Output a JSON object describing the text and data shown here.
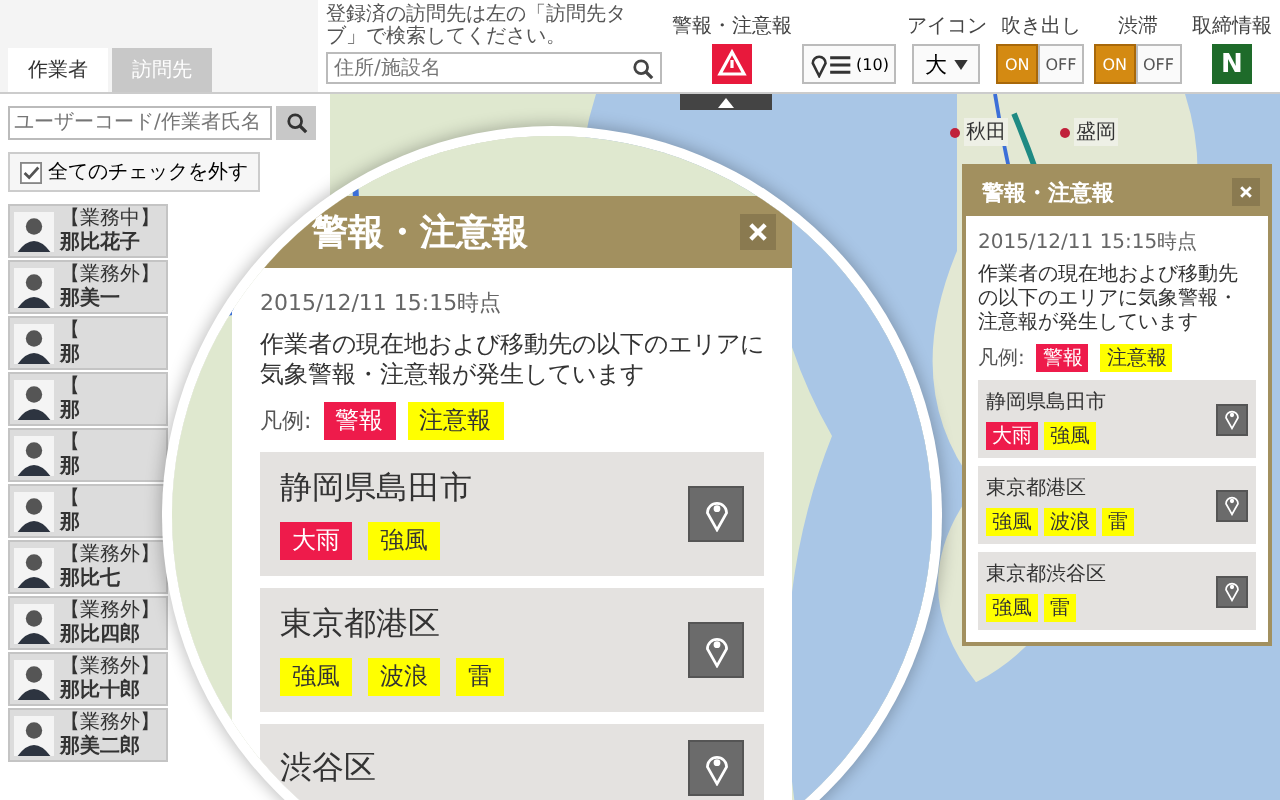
{
  "sidebar": {
    "tabs": [
      {
        "label": "作業者",
        "selected": true
      },
      {
        "label": "訪問先",
        "selected": false
      }
    ],
    "search": {
      "placeholder": "ユーザーコード/作業者氏名"
    },
    "uncheck_all": {
      "label": "全てのチェックを外す",
      "checked": true
    },
    "workers": [
      {
        "status": "【業務中】",
        "name": "那比花子"
      },
      {
        "status": "【業務外】",
        "name": "那美一"
      },
      {
        "status": "【",
        "name": "那"
      },
      {
        "status": "【",
        "name": "那"
      },
      {
        "status": "【",
        "name": "那"
      },
      {
        "status": "【",
        "name": "那"
      },
      {
        "status": "【業務外】",
        "name": "那比七"
      },
      {
        "status": "【業務外】",
        "name": "那比四郎"
      },
      {
        "status": "【業務外】",
        "name": "那比十郎"
      },
      {
        "status": "【業務外】",
        "name": "那美二郎"
      }
    ]
  },
  "toolbar": {
    "hint": "登録済の訪問先は左の「訪問先タブ」で検索してください。",
    "search": {
      "placeholder": "住所/施設名"
    },
    "alert": {
      "label": "警報・注意報"
    },
    "pin_list": {
      "count": "(10)"
    },
    "icon_size": {
      "label": "アイコン",
      "value": "大"
    },
    "toggles": [
      {
        "label": "吹き出し",
        "options": [
          {
            "label": "ON",
            "selected": true
          },
          {
            "label": "OFF",
            "selected": false
          }
        ]
      },
      {
        "label": "渋滞",
        "options": [
          {
            "label": "ON",
            "selected": true
          },
          {
            "label": "OFF",
            "selected": false
          }
        ]
      }
    ],
    "enforcement": {
      "label": "取締情報",
      "letter": "N"
    }
  },
  "map": {
    "places": [
      {
        "label": "秋田"
      },
      {
        "label": "盛岡"
      }
    ]
  },
  "magnified_dialog": {
    "title": "警報・注意報",
    "time": "2015/12/11 15:15時点",
    "message": "作業者の現在地および移動先の以下のエリアに気象警報・注意報が発生しています",
    "legend_label": "凡例:",
    "legend": [
      {
        "label": "警報",
        "kind": "warning"
      },
      {
        "label": "注意報",
        "kind": "advisory"
      }
    ],
    "areas": [
      {
        "name": "静岡県島田市",
        "tags": [
          {
            "label": "大雨",
            "kind": "warning"
          },
          {
            "label": "強風",
            "kind": "advisory"
          }
        ]
      },
      {
        "name": "東京都港区",
        "tags": [
          {
            "label": "強風",
            "kind": "advisory"
          },
          {
            "label": "波浪",
            "kind": "advisory"
          },
          {
            "label": "雷",
            "kind": "advisory"
          }
        ]
      },
      {
        "name": "渋谷区"
      }
    ]
  },
  "side_dialog": {
    "title": "警報・注意報",
    "time": "2015/12/11 15:15時点",
    "message": "作業者の現在地および移動先の以下のエリアに気象警報・注意報が発生しています",
    "legend_label": "凡例:",
    "legend": [
      {
        "label": "警報",
        "kind": "warning"
      },
      {
        "label": "注意報",
        "kind": "advisory"
      }
    ],
    "areas": [
      {
        "name": "静岡県島田市",
        "tags": [
          {
            "label": "大雨",
            "kind": "warning"
          },
          {
            "label": "強風",
            "kind": "advisory"
          }
        ]
      },
      {
        "name": "東京都港区",
        "tags": [
          {
            "label": "強風",
            "kind": "advisory"
          },
          {
            "label": "波浪",
            "kind": "advisory"
          },
          {
            "label": "雷",
            "kind": "advisory"
          }
        ]
      },
      {
        "name": "東京都渋谷区",
        "tags": [
          {
            "label": "強風",
            "kind": "advisory"
          },
          {
            "label": "雷",
            "kind": "advisory"
          }
        ]
      }
    ]
  }
}
